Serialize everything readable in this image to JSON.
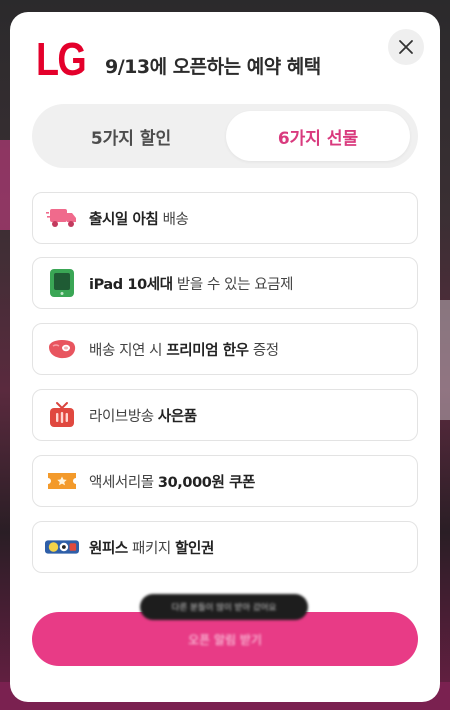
{
  "brand": {
    "logo_text": "LG",
    "logo_color": "#e4002b",
    "accent": "#e83b86"
  },
  "header": {
    "title": "9/13에 오픈하는 예약 혜택",
    "close_icon": "close-icon"
  },
  "tabs": [
    {
      "label": "5가지 할인",
      "selected": false
    },
    {
      "label": "6가지 선물",
      "selected": true
    }
  ],
  "benefits": [
    {
      "icon": "delivery-truck-icon",
      "bold": "출시일 아침",
      "text": " 배송"
    },
    {
      "icon": "tablet-icon",
      "bold": "iPad 10세대",
      "text": " 받을 수 있는 요금제"
    },
    {
      "icon": "beef-icon",
      "pre": "배송 지연 시 ",
      "bold": "프리미엄 한우",
      "text": " 증정"
    },
    {
      "icon": "live-tv-icon",
      "pre": "라이브방송 ",
      "bold": "사은품",
      "text": ""
    },
    {
      "icon": "coupon-icon",
      "pre": "액세서리몰 ",
      "bold": "30,000원 쿠폰",
      "text": ""
    },
    {
      "icon": "one-piece-logo-icon",
      "bold": "원피스",
      "text": " 패키지 ",
      "bold2": "할인권"
    }
  ],
  "tooltip": {
    "text": "다른 분들이 많이 받아 갔어요"
  },
  "cta": {
    "label": "오픈 알림 받기"
  }
}
